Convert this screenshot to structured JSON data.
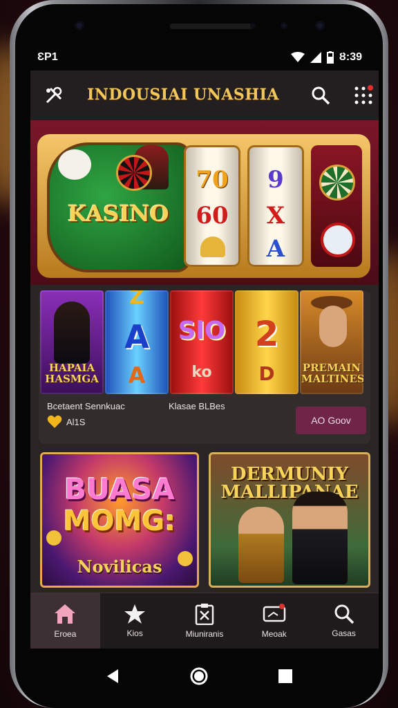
{
  "status": {
    "carrier": "ƐP1",
    "time": "Ȣ:39"
  },
  "appbar": {
    "title": "INDOUSIAI UNASHIA",
    "menu_icon": "tools-icon",
    "search_icon": "search-icon",
    "grid_icon": "grid-icon"
  },
  "hero": {
    "logo": "KASINO",
    "reels": [
      [
        "70",
        "60"
      ],
      [
        "9",
        "X",
        "A"
      ]
    ]
  },
  "games_row": {
    "tiles": [
      {
        "caption": "HAPAIA HASMGA"
      },
      {
        "symbol_top": "Z",
        "symbol_main": "A",
        "symbol_bottom": "A"
      },
      {
        "symbol_main": "SlO",
        "symbol_bottom": "ko"
      },
      {
        "symbol_main": "2",
        "symbol_bottom": "D"
      },
      {
        "caption": "PREMAIN MALTINES"
      }
    ],
    "left_label": "Βcetaent Sennkuac",
    "right_label": "Klasae ΒLΒes",
    "rating_text": "Al1S",
    "go_button": "AO Goov"
  },
  "promo_cards": [
    {
      "line1": "BUASA",
      "line2": "MOMG:",
      "line3": "Novilicas"
    },
    {
      "title": "DERMUNIY MALLIPANAE"
    }
  ],
  "bottom_nav": [
    {
      "label": "Eroea",
      "icon": "home-icon",
      "active": true
    },
    {
      "label": "Kios",
      "icon": "star-icon",
      "active": false
    },
    {
      "label": "Miuniranis",
      "icon": "clipboard-icon",
      "active": false
    },
    {
      "label": "Meoak",
      "icon": "message-icon",
      "active": false
    },
    {
      "label": "Gasas",
      "icon": "search-icon",
      "active": false
    }
  ]
}
